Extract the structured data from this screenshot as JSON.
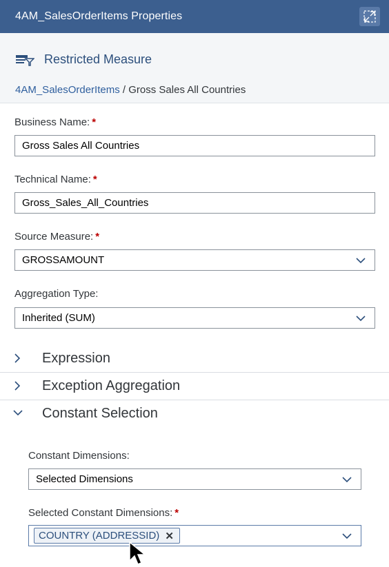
{
  "window": {
    "title": "4AM_SalesOrderItems Properties"
  },
  "header": {
    "object_type": "Restricted Measure",
    "breadcrumb_link": "4AM_SalesOrderItems",
    "breadcrumb_sep": " / ",
    "breadcrumb_current": "Gross Sales All Countries"
  },
  "form": {
    "business_name": {
      "label": "Business Name:",
      "required": "*",
      "value": "Gross Sales All Countries"
    },
    "technical_name": {
      "label": "Technical Name:",
      "required": "*",
      "value": "Gross_Sales_All_Countries"
    },
    "source_measure": {
      "label": "Source Measure:",
      "required": "*",
      "value": "GROSSAMOUNT"
    },
    "aggregation_type": {
      "label": "Aggregation Type:",
      "value": "Inherited (SUM)"
    }
  },
  "panels": {
    "expression": {
      "title": "Expression",
      "expanded": false
    },
    "exception_aggregation": {
      "title": "Exception Aggregation",
      "expanded": false
    },
    "constant_selection": {
      "title": "Constant Selection",
      "expanded": true,
      "constant_dimensions": {
        "label": "Constant Dimensions:",
        "value": "Selected Dimensions"
      },
      "selected_constant_dimensions": {
        "label": "Selected Constant Dimensions:",
        "required": "*",
        "tokens": [
          "COUNTRY (ADDRESSID)"
        ],
        "remove_glyph": "✕"
      }
    }
  },
  "colors": {
    "title_bar": "#3c5f8f",
    "link": "#2f5f9e",
    "required": "#bb0000"
  },
  "icons": [
    "expand-icon",
    "restricted-measure-icon",
    "chevron-down-icon",
    "chevron-right-icon",
    "mouse-cursor-icon"
  ]
}
